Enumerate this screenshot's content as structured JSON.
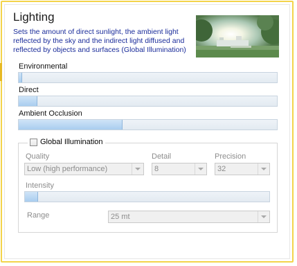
{
  "panel": {
    "title": "Lighting",
    "description": "Sets the amount of direct sunlight, the ambient light reflected by the sky and the indirect light diffused and reflected by objects and surfaces (Global Illumination)"
  },
  "sliders": {
    "environmental": {
      "label": "Environmental",
      "level": 0.01
    },
    "direct": {
      "label": "Direct",
      "level": 0.07
    },
    "ambient_occlusion": {
      "label": "Ambient Occlusion",
      "level": 0.4
    }
  },
  "global_illumination": {
    "label": "Global Illumination",
    "checked": false,
    "quality": {
      "label": "Quality",
      "value": "Low (high performance)"
    },
    "detail": {
      "label": "Detail",
      "value": "8"
    },
    "precision": {
      "label": "Precision",
      "value": "32"
    },
    "intensity": {
      "label": "Intensity",
      "level": 0.05
    },
    "range": {
      "label": "Range",
      "value": "25 mt"
    }
  },
  "colors": {
    "frame_border": "#f3d44a",
    "description_text": "#1a2c9a",
    "slider_fill": "#a9cdef"
  },
  "icons": {
    "preview": "lighting-preview-thumbnail"
  }
}
